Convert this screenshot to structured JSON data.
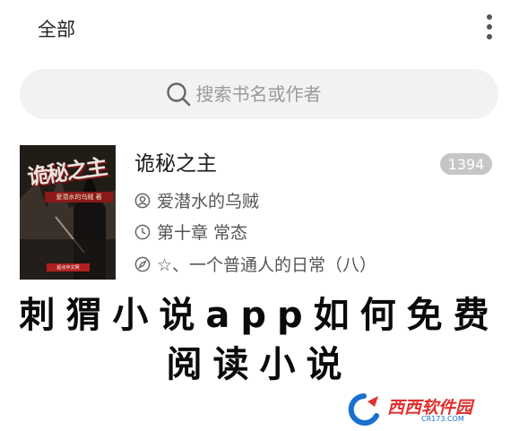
{
  "header": {
    "title": "全部"
  },
  "search": {
    "placeholder": "搜索书名或作者"
  },
  "book": {
    "cover_title": "诡秘之主",
    "cover_subtitle": "爱潜水的乌贼 著",
    "cover_publisher": "起点中文网",
    "title": "诡秘之主",
    "count": "1394",
    "author": "爱潜水的乌贼",
    "latest_chapter": "第十章 常态",
    "reading_chapter": "☆、一个普通人的日常（八）"
  },
  "banner": {
    "line1": "刺猬小说app如何免费",
    "line2": "阅读小说"
  },
  "watermark": {
    "text": "西西软件园",
    "url_text": "CR173.COM"
  },
  "icons": {
    "more": "more-vertical-icon",
    "search": "search-icon",
    "author": "user-circle-icon",
    "latest": "clock-icon",
    "reading": "compass-icon"
  },
  "colors": {
    "badge": "#c6c6c8",
    "search_bg": "#f1f2f4",
    "watermark_red": "#e03030",
    "watermark_blue": "#1a6fd0"
  }
}
